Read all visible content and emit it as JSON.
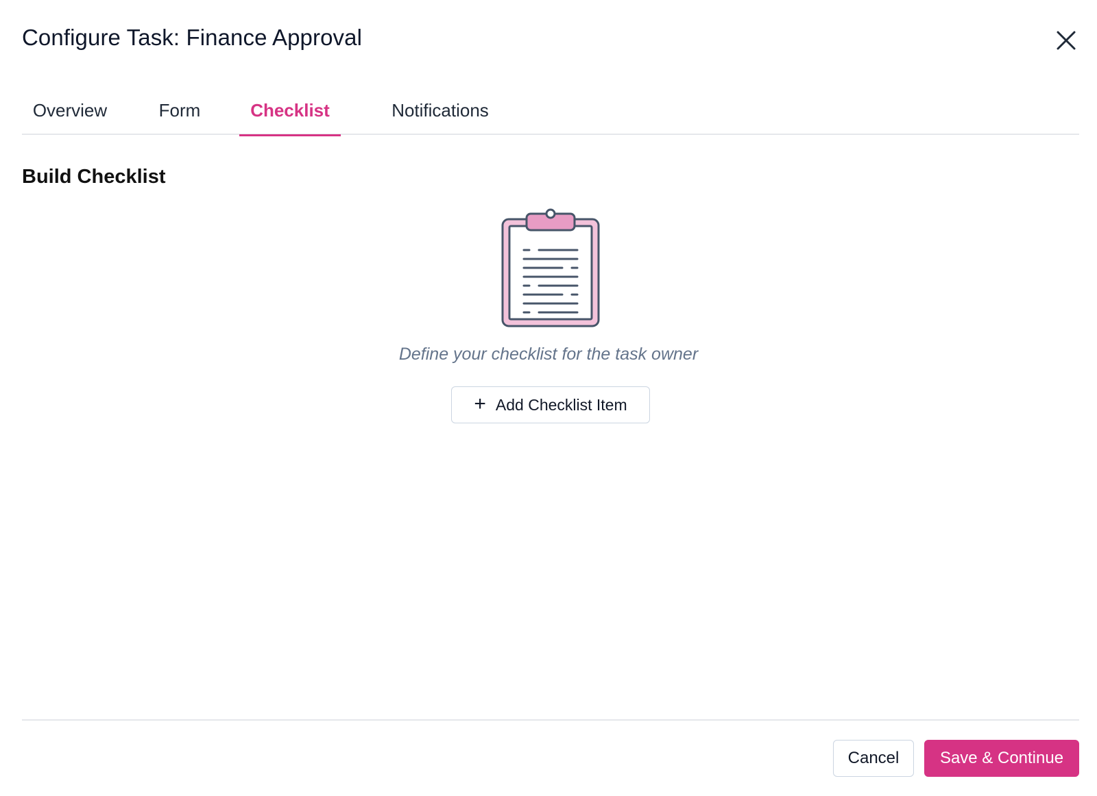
{
  "dialog": {
    "title": "Configure Task: Finance Approval",
    "close_icon": "close-icon"
  },
  "tabs": [
    {
      "label": "Overview",
      "active": false
    },
    {
      "label": "Form",
      "active": false
    },
    {
      "label": "Checklist",
      "active": true
    },
    {
      "label": "Notifications",
      "active": false
    }
  ],
  "main": {
    "section_title": "Build Checklist",
    "illustration_icon": "clipboard-icon",
    "hint": "Define your checklist for the task owner",
    "add_button_label": "Add Checklist Item",
    "add_button_icon": "plus-icon"
  },
  "footer": {
    "cancel_label": "Cancel",
    "save_label": "Save & Continue"
  },
  "colors": {
    "accent": "#d63384",
    "clipboard_fill": "#f3c2da",
    "line": "#475569"
  }
}
